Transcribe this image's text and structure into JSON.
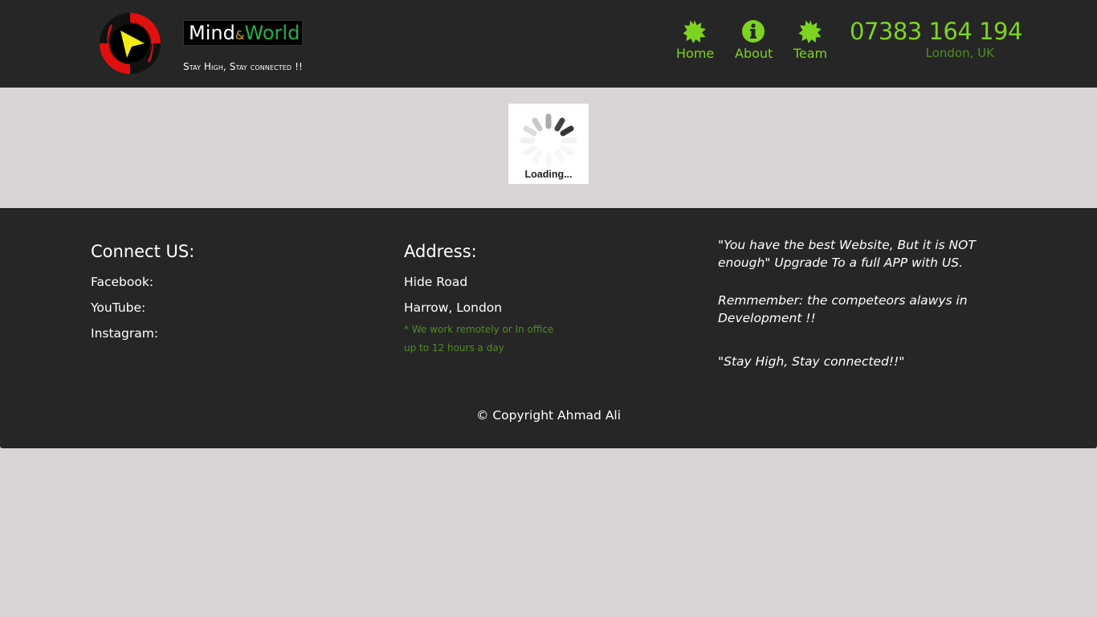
{
  "header": {
    "brand": {
      "mind": "Mind",
      "amp": "&",
      "world": "World"
    },
    "tagline": "Stay High, Stay connected !!",
    "nav": [
      {
        "label": "Home",
        "icon": "badge-star-icon"
      },
      {
        "label": "About",
        "icon": "info-icon"
      },
      {
        "label": "Team",
        "icon": "badge-star-icon"
      }
    ],
    "phone": "07383 164 194",
    "location": "London, UK"
  },
  "loader": {
    "text": "Loading..."
  },
  "footer": {
    "connect": {
      "title": "Connect US:",
      "items": [
        "Facebook:",
        "YouTube:",
        "Instagram:"
      ]
    },
    "address": {
      "title": "Address:",
      "lines": [
        "Hide Road",
        "Harrow, London"
      ],
      "notes": [
        "* We work remotely or In office",
        "up to 12 hours a day"
      ]
    },
    "quotes": [
      "\"You have the best Website, But it is NOT enough\" Upgrade To a full APP with US.",
      "Remmember: the competeors alawys in Development !!",
      "\"Stay High, Stay connected!!\""
    ],
    "copyright": "© Copyright Ahmad Ali"
  },
  "colors": {
    "accent": "#7ed321",
    "accent_dark": "#4f8d23",
    "header_bg": "#262626",
    "page_bg": "#d9d4d6"
  }
}
